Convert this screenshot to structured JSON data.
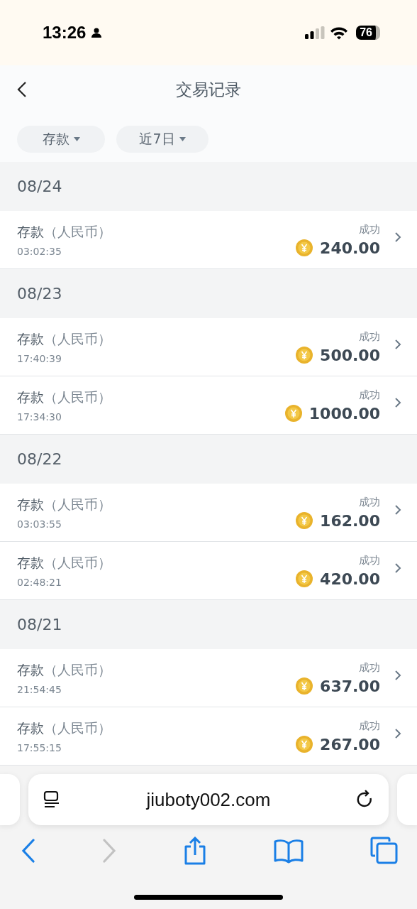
{
  "status_bar": {
    "time": "13:26",
    "battery": "76"
  },
  "header": {
    "title": "交易记录"
  },
  "filters": [
    {
      "label": "存款"
    },
    {
      "label": "近7日"
    }
  ],
  "groups": [
    {
      "date": "08/24",
      "rows": [
        {
          "title": "存款",
          "currency": "（人民币）",
          "time": "03:02:35",
          "status": "成功",
          "amount": "240.00"
        }
      ]
    },
    {
      "date": "08/23",
      "rows": [
        {
          "title": "存款",
          "currency": "（人民币）",
          "time": "17:40:39",
          "status": "成功",
          "amount": "500.00"
        },
        {
          "title": "存款",
          "currency": "（人民币）",
          "time": "17:34:30",
          "status": "成功",
          "amount": "1000.00"
        }
      ]
    },
    {
      "date": "08/22",
      "rows": [
        {
          "title": "存款",
          "currency": "（人民币）",
          "time": "03:03:55",
          "status": "成功",
          "amount": "162.00"
        },
        {
          "title": "存款",
          "currency": "（人民币）",
          "time": "02:48:21",
          "status": "成功",
          "amount": "420.00"
        }
      ]
    },
    {
      "date": "08/21",
      "rows": [
        {
          "title": "存款",
          "currency": "（人民币）",
          "time": "21:54:45",
          "status": "成功",
          "amount": "637.00"
        },
        {
          "title": "存款",
          "currency": "（人民币）",
          "time": "17:55:15",
          "status": "成功",
          "amount": "267.00"
        }
      ]
    }
  ],
  "browser": {
    "url": "jiuboty002.com",
    "nav": [
      {
        "kind": "back",
        "disabled": false
      },
      {
        "kind": "forward",
        "disabled": true
      }
    ]
  }
}
